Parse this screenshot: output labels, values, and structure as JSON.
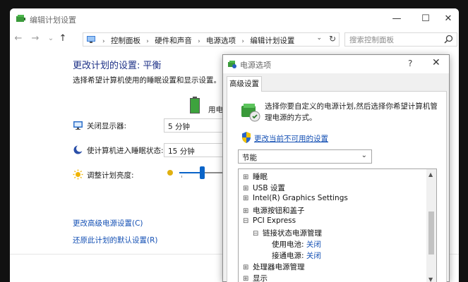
{
  "window": {
    "title": "编辑计划设置",
    "minimize": "—",
    "maximize": "☐",
    "close": "✕"
  },
  "nav": {
    "back": "←",
    "forward": "→",
    "recent": "⌄",
    "up": "↑"
  },
  "address": {
    "crumbs": [
      "控制面板",
      "硬件和声音",
      "电源选项",
      "编辑计划设置"
    ],
    "separator": "›",
    "dropdown": "⌄",
    "refresh": "↻"
  },
  "search": {
    "placeholder": "搜索控制面板"
  },
  "page": {
    "title": "更改计划的设置: 平衡",
    "subtitle": "选择希望计算机使用的睡眠设置和显示设置。",
    "battery_label": "用电",
    "settings": [
      {
        "label": "关闭显示器:",
        "value": "5 分钟"
      },
      {
        "label": "使计算机进入睡眠状态:",
        "value": "15 分钟"
      },
      {
        "label": "调整计划亮度:"
      }
    ],
    "brightness_fraction": 0.45,
    "links": [
      "更改高级电源设置(C)",
      "还原此计划的默认设置(R)"
    ]
  },
  "dialog": {
    "title": "电源选项",
    "help": "?",
    "close": "✕",
    "tab": "高级设置",
    "description": "选择你要自定义的电源计划,然后选择你希望计算机管理电源的方式。",
    "change_link": "更改当前不可用的设置",
    "plan_selected": "节能",
    "plan_chevron": "⌄",
    "tree": [
      {
        "exp": "⊞",
        "label": "睡眠",
        "level": 0
      },
      {
        "exp": "⊞",
        "label": "USB 设置",
        "level": 0
      },
      {
        "exp": "⊞",
        "label": "Intel(R) Graphics Settings",
        "level": 0
      },
      {
        "exp": "⊞",
        "label": "电源按钮和盖子",
        "level": 0
      },
      {
        "exp": "⊟",
        "label": "PCI Express",
        "level": 0
      },
      {
        "exp": "⊟",
        "label": "链接状态电源管理",
        "level": 1
      },
      {
        "exp": "",
        "label": "使用电池:",
        "value": "关闭",
        "level": 2
      },
      {
        "exp": "",
        "label": "接通电源:",
        "value": "关闭",
        "level": 2
      },
      {
        "exp": "⊞",
        "label": "处理器电源管理",
        "level": 0
      },
      {
        "exp": "⊞",
        "label": "显示",
        "level": 0
      }
    ],
    "scroll_up": "▲",
    "scroll_down": "▼"
  },
  "colors": {
    "title_blue": "#1e3287",
    "link_blue": "#1450b4",
    "accent": "#0a64c8"
  }
}
